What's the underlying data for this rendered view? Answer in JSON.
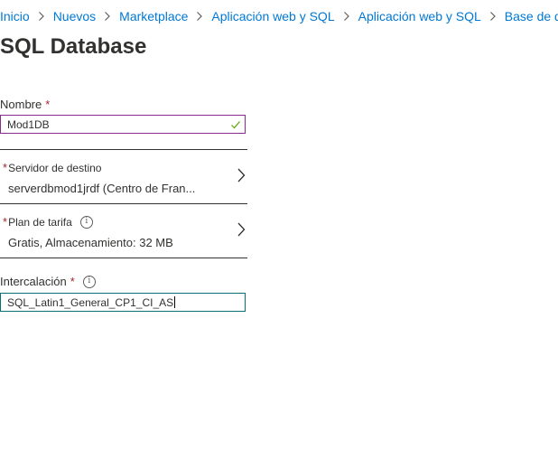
{
  "breadcrumb": {
    "items": [
      "Inicio",
      "Nuevos",
      "Marketplace",
      "Aplicación web y SQL",
      "Aplicación web y SQL",
      "Base de datos"
    ]
  },
  "page": {
    "title": "SQL Database"
  },
  "fields": {
    "nombre": {
      "label": "Nombre",
      "required_mark": "*",
      "value": "Mod1DB"
    },
    "servidor": {
      "required_mark": "*",
      "label": "Servidor de destino",
      "value": "serverdbmod1jrdf (Centro de Fran..."
    },
    "plan": {
      "required_mark": "*",
      "label": "Plan de tarifa",
      "value": "Gratis, Almacenamiento: 32 MB"
    },
    "intercalacion": {
      "label": "Intercalación",
      "required_mark": "*",
      "value": "SQL_Latin1_General_CP1_CI_AS"
    }
  },
  "icons": {
    "separator": "chevron-right-icon",
    "valid": "checkmark-icon",
    "info": "info-icon",
    "picker": "chevron-right-icon"
  },
  "colors": {
    "link": "#0078d4",
    "required": "#a4262c",
    "valid_border": "#8a2c8f",
    "focus_border": "#0a6f73",
    "check": "#57a300"
  }
}
